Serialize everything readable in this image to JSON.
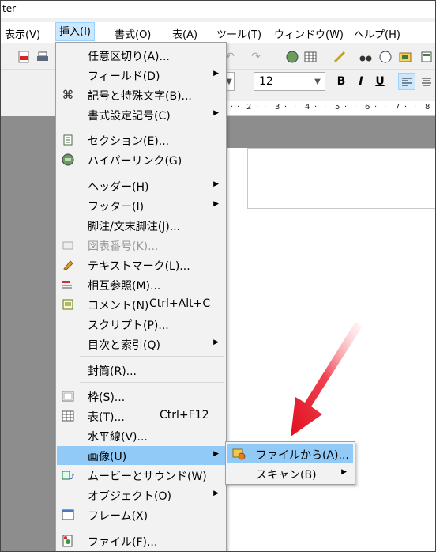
{
  "window": {
    "title_fragment": "ter"
  },
  "menubar": [
    {
      "label": "表示(V)"
    },
    {
      "label": "挿入(I)"
    },
    {
      "label": "書式(O)"
    },
    {
      "label": "表(A)"
    },
    {
      "label": "ツール(T)"
    },
    {
      "label": "ウィンドウ(W)"
    },
    {
      "label": "ヘルプ(H)"
    }
  ],
  "toolbar": {
    "font_size": "12",
    "bold": "B",
    "italic": "I",
    "underline": "U"
  },
  "ruler": {
    "ticks": [
      "2",
      "3",
      "4",
      "5",
      "6",
      "7",
      "8"
    ]
  },
  "insert_menu": {
    "items": [
      {
        "label": "任意区切り(A)...",
        "icon": "none"
      },
      {
        "label": "フィールド(D)",
        "icon": "none",
        "submenu": true
      },
      {
        "label": "記号と特殊文字(B)...",
        "icon": "omega-icon"
      },
      {
        "label": "書式設定記号(C)",
        "icon": "none",
        "submenu": true
      },
      {
        "label": "セクション(E)...",
        "icon": "section-icon"
      },
      {
        "label": "ハイパーリンク(G)",
        "icon": "hyperlink-icon"
      },
      {
        "label": "ヘッダー(H)",
        "icon": "none",
        "submenu": true
      },
      {
        "label": "フッター(I)",
        "icon": "none",
        "submenu": true
      },
      {
        "label": "脚注/文末脚注(J)...",
        "icon": "none"
      },
      {
        "label": "図表番号(K)...",
        "icon": "caption-icon",
        "disabled": true
      },
      {
        "label": "テキストマーク(L)...",
        "icon": "bookmark-icon"
      },
      {
        "label": "相互参照(M)...",
        "icon": "cross-reference-icon"
      },
      {
        "label": "コメント(N)",
        "shortcut": "Ctrl+Alt+C",
        "icon": "comment-icon"
      },
      {
        "label": "スクリプト(P)...",
        "icon": "none"
      },
      {
        "label": "目次と索引(Q)",
        "icon": "none",
        "submenu": true
      },
      {
        "label": "封筒(R)...",
        "icon": "none"
      },
      {
        "label": "枠(S)...",
        "icon": "frame-icon"
      },
      {
        "label": "表(T)...",
        "shortcut": "Ctrl+F12",
        "icon": "table-icon"
      },
      {
        "label": "水平線(V)...",
        "icon": "none"
      },
      {
        "label": "画像(U)",
        "icon": "none",
        "submenu": true,
        "highlighted": true
      },
      {
        "label": "ムービーとサウンド(W)",
        "icon": "movie-sound-icon"
      },
      {
        "label": "オブジェクト(O)",
        "icon": "none",
        "submenu": true
      },
      {
        "label": "フレーム(X)",
        "icon": "frame-window-icon"
      },
      {
        "label": "ファイル(F)...",
        "icon": "insert-file-icon"
      }
    ]
  },
  "image_submenu": {
    "items": [
      {
        "label": "ファイルから(A)...",
        "icon": "image-from-file-icon",
        "highlighted": true
      },
      {
        "label": "スキャン(B)",
        "submenu": true
      }
    ]
  },
  "colors": {
    "highlight": "#91c9f7",
    "arrow": "#e8102a",
    "doc_background": "#8d8d8d"
  }
}
